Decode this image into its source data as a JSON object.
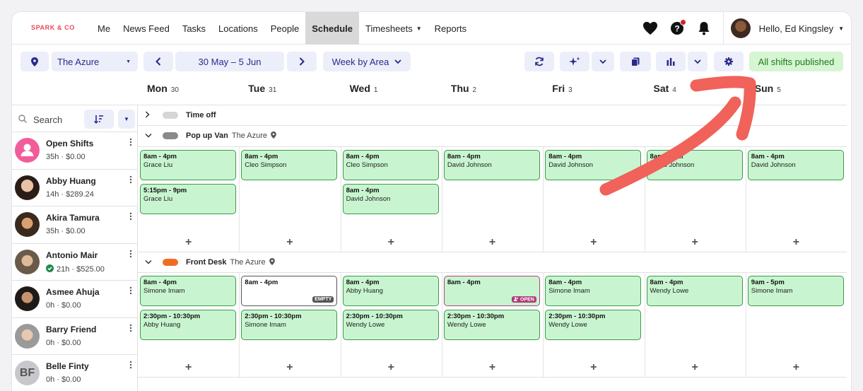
{
  "brand": "SPARK & CO",
  "nav": {
    "links": [
      {
        "label": "Me"
      },
      {
        "label": "News Feed"
      },
      {
        "label": "Tasks"
      },
      {
        "label": "Locations"
      },
      {
        "label": "People"
      },
      {
        "label": "Schedule",
        "active": true
      },
      {
        "label": "Timesheets",
        "dropdown": true
      },
      {
        "label": "Reports"
      }
    ],
    "user_greeting": "Hello, Ed Kingsley"
  },
  "toolbar": {
    "location": "The Azure",
    "date_range": "30 May – 5 Jun",
    "view": "Week by Area",
    "status": "All shifts published"
  },
  "days": [
    {
      "name": "Mon",
      "num": "30"
    },
    {
      "name": "Tue",
      "num": "31"
    },
    {
      "name": "Wed",
      "num": "1"
    },
    {
      "name": "Thu",
      "num": "2"
    },
    {
      "name": "Fri",
      "num": "3"
    },
    {
      "name": "Sat",
      "num": "4"
    },
    {
      "name": "Sun",
      "num": "5"
    }
  ],
  "search": {
    "placeholder": "Search"
  },
  "people": [
    {
      "name": "Open Shifts",
      "info": "35h · $0.00"
    },
    {
      "name": "Abby Huang",
      "info": "14h · $289.24"
    },
    {
      "name": "Akira Tamura",
      "info": "35h · $0.00"
    },
    {
      "name": "Antonio Mair",
      "info": "21h · $525.00",
      "verified": true
    },
    {
      "name": "Asmee Ahuja",
      "info": "0h · $0.00"
    },
    {
      "name": "Barry Friend",
      "info": "0h · $0.00"
    },
    {
      "name": "Belle Finty",
      "info": "0h · $0.00",
      "initials": "BF"
    }
  ],
  "areas": [
    {
      "name": "Time off",
      "loc": ""
    },
    {
      "name": "Pop up Van",
      "loc": "The Azure"
    },
    {
      "name": "Front Desk",
      "loc": "The Azure"
    }
  ],
  "shifts": {
    "popup": [
      [
        {
          "time": "8am - 4pm",
          "who": "Grace Liu"
        },
        {
          "time": "5:15pm - 9pm",
          "who": "Grace Liu"
        }
      ],
      [
        {
          "time": "8am - 4pm",
          "who": "Cleo Simpson"
        }
      ],
      [
        {
          "time": "8am - 4pm",
          "who": "Cleo Simpson"
        },
        {
          "time": "8am - 4pm",
          "who": "David Johnson"
        }
      ],
      [
        {
          "time": "8am - 4pm",
          "who": "David Johnson"
        }
      ],
      [
        {
          "time": "8am - 4pm",
          "who": "David Johnson"
        }
      ],
      [
        {
          "time": "8am - 4pm",
          "who": "David Johnson"
        }
      ],
      [
        {
          "time": "8am - 4pm",
          "who": "David Johnson"
        }
      ]
    ],
    "frontdesk": [
      [
        {
          "time": "8am - 4pm",
          "who": "Simone Imam"
        },
        {
          "time": "2:30pm - 10:30pm",
          "who": "Abby Huang"
        }
      ],
      [
        {
          "time": "8am - 4pm",
          "who": "",
          "badge": "EMPTY"
        },
        {
          "time": "2:30pm - 10:30pm",
          "who": "Simone Imam"
        }
      ],
      [
        {
          "time": "8am - 4pm",
          "who": "Abby Huang"
        },
        {
          "time": "2:30pm - 10:30pm",
          "who": "Wendy Lowe"
        }
      ],
      [
        {
          "time": "8am - 4pm",
          "who": "",
          "badge": "OPEN"
        },
        {
          "time": "2:30pm - 10:30pm",
          "who": "Wendy Lowe"
        }
      ],
      [
        {
          "time": "8am - 4pm",
          "who": "Simone Imam"
        },
        {
          "time": "2:30pm - 10:30pm",
          "who": "Wendy Lowe"
        }
      ],
      [
        {
          "time": "8am - 4pm",
          "who": "Wendy Lowe"
        }
      ],
      [
        {
          "time": "9am - 5pm",
          "who": "Simone Imam"
        }
      ]
    ]
  },
  "colors": {
    "accent": "#2a2a8a",
    "shift_fill": "#c8f5d0",
    "shift_border": "#3c9a4a",
    "open_badge": "#b03a78",
    "arrow": "#f0625a",
    "popup_van": "#8a8a8a",
    "front_desk": "#f26b22"
  }
}
